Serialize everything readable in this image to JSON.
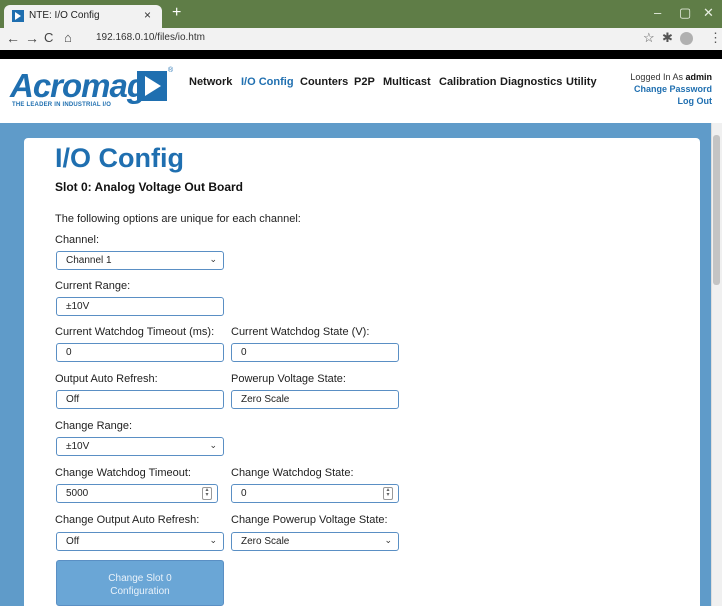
{
  "browser": {
    "tab_title": "NTE: I/O Config",
    "tab_close": "×",
    "new_tab": "+",
    "url": "192.168.0.10/files/io.htm",
    "window_minimize": "–",
    "window_restore": "▢",
    "window_close": "✕"
  },
  "header": {
    "logo_text": "Acromag",
    "logo_reg": "®",
    "logo_tagline": "THE LEADER IN INDUSTRIAL I/O",
    "nav": [
      {
        "label": "Network"
      },
      {
        "label": "I/O Config"
      },
      {
        "label": "Counters"
      },
      {
        "label": "P2P"
      },
      {
        "label": "Multicast"
      },
      {
        "label": "Calibration"
      },
      {
        "label": "Diagnostics"
      },
      {
        "label": "Utility"
      }
    ],
    "active_nav": "I/O Config",
    "logged_in_prefix": "Logged In As",
    "logged_in_user": "admin",
    "change_password": "Change Password",
    "log_out": "Log Out"
  },
  "main": {
    "title": "I/O Config",
    "subtitle": "Slot 0: Analog Voltage Out Board",
    "intro": "The following options are unique for each channel:",
    "channel": {
      "label": "Channel:",
      "value": "Channel 1"
    },
    "current_range": {
      "label": "Current Range:",
      "value": "±10V"
    },
    "current_watchdog_timeout": {
      "label": "Current Watchdog Timeout (ms):",
      "value": "0"
    },
    "current_watchdog_state": {
      "label": "Current Watchdog State (V):",
      "value": "0"
    },
    "output_auto_refresh": {
      "label": "Output Auto Refresh:",
      "value": "Off"
    },
    "powerup_voltage_state": {
      "label": "Powerup Voltage State:",
      "value": "Zero Scale"
    },
    "change_range": {
      "label": "Change Range:",
      "value": "±10V"
    },
    "change_watchdog_timeout": {
      "label": "Change Watchdog Timeout:",
      "value": "5000"
    },
    "change_watchdog_state": {
      "label": "Change Watchdog State:",
      "value": "0"
    },
    "change_output_auto_refresh": {
      "label": "Change Output Auto Refresh:",
      "value": "Off"
    },
    "change_powerup_voltage_state": {
      "label": "Change Powerup Voltage State:",
      "value": "Zero Scale"
    },
    "submit_line1": "Change Slot 0",
    "submit_line2": "Configuration"
  },
  "colors": {
    "brand_blue": "#1f6fb0",
    "page_background": "#5f9bc9",
    "button_disabled": "#6aa6d6",
    "browser_chrome": "#5f7d47"
  }
}
